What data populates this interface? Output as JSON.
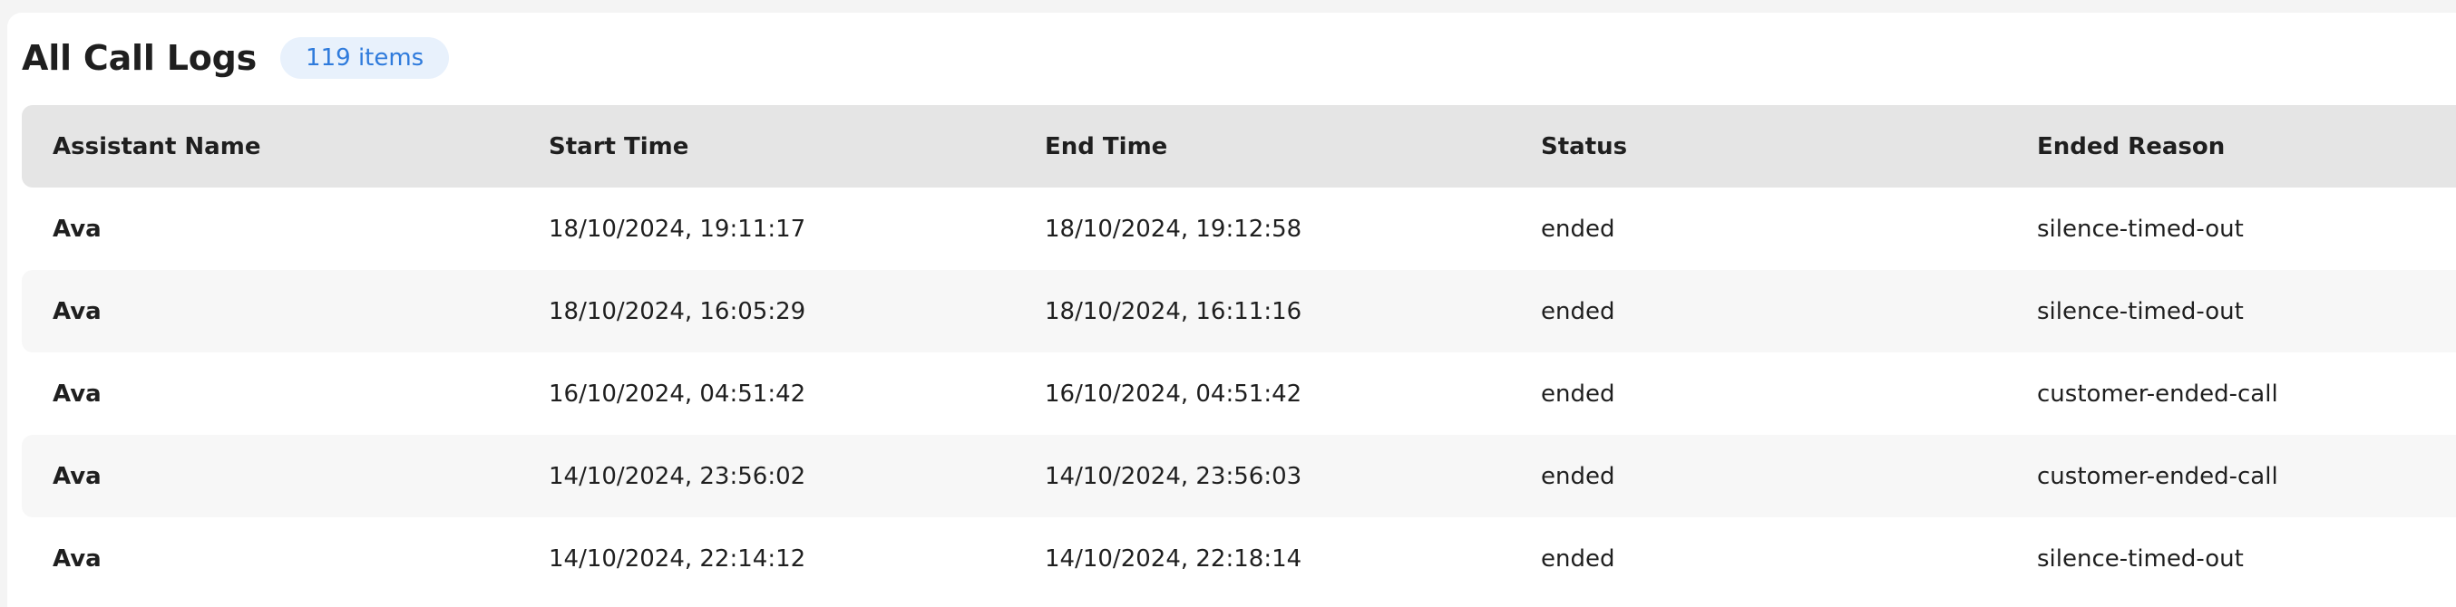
{
  "page": {
    "title": "All Call Logs",
    "count_badge": "119 items"
  },
  "table": {
    "columns": [
      "Assistant Name",
      "Start Time",
      "End Time",
      "Status",
      "Ended Reason"
    ],
    "rows": [
      [
        "Ava",
        "18/10/2024, 19:11:17",
        "18/10/2024, 19:12:58",
        "ended",
        "silence-timed-out"
      ],
      [
        "Ava",
        "18/10/2024, 16:05:29",
        "18/10/2024, 16:11:16",
        "ended",
        "silence-timed-out"
      ],
      [
        "Ava",
        "16/10/2024, 04:51:42",
        "16/10/2024, 04:51:42",
        "ended",
        "customer-ended-call"
      ],
      [
        "Ava",
        "14/10/2024, 23:56:02",
        "14/10/2024, 23:56:03",
        "ended",
        "customer-ended-call"
      ],
      [
        "Ava",
        "14/10/2024, 22:14:12",
        "14/10/2024, 22:18:14",
        "ended",
        "silence-timed-out"
      ]
    ]
  },
  "colors": {
    "accent": "#2f7bdc",
    "badge_bg": "#e8f1fc",
    "header_bg": "#e5e5e5",
    "alt_row_bg": "#f7f7f7"
  }
}
